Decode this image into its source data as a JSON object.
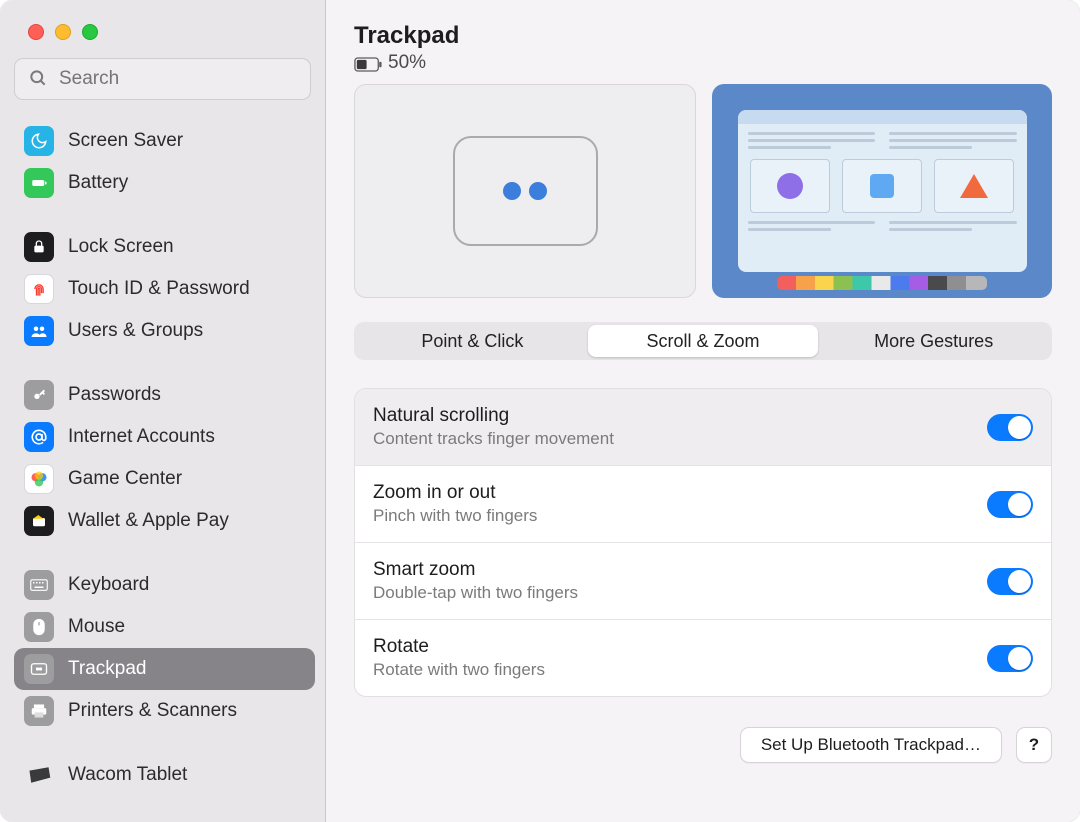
{
  "search_placeholder": "Search",
  "header": {
    "title": "Trackpad",
    "battery_percent": "50%"
  },
  "tabs": {
    "point": "Point & Click",
    "scroll": "Scroll & Zoom",
    "more": "More Gestures"
  },
  "settings": {
    "natural": {
      "title": "Natural scrolling",
      "sub": "Content tracks finger movement"
    },
    "zoom": {
      "title": "Zoom in or out",
      "sub": "Pinch with two fingers"
    },
    "smart": {
      "title": "Smart zoom",
      "sub": "Double-tap with two fingers"
    },
    "rotate": {
      "title": "Rotate",
      "sub": "Rotate with two fingers"
    }
  },
  "footer": {
    "bluetooth": "Set Up Bluetooth Trackpad…",
    "help": "?"
  },
  "sidebar": {
    "screen_saver": "Screen Saver",
    "battery": "Battery",
    "lock_screen": "Lock Screen",
    "touch_id": "Touch ID & Password",
    "users": "Users & Groups",
    "passwords": "Passwords",
    "internet": "Internet Accounts",
    "game_center": "Game Center",
    "wallet": "Wallet & Apple Pay",
    "keyboard": "Keyboard",
    "mouse": "Mouse",
    "trackpad": "Trackpad",
    "printers": "Printers & Scanners",
    "wacom": "Wacom Tablet"
  }
}
